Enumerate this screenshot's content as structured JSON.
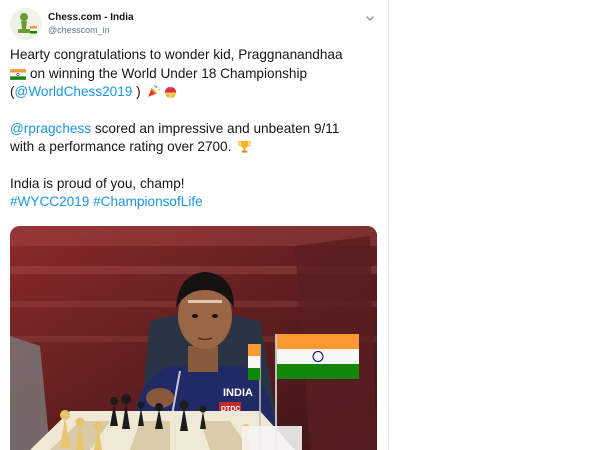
{
  "tweet": {
    "author_name": "Chess.com - India",
    "author_handle": "@chesscom_in",
    "lines": {
      "l1": "Hearty congratulations to wonder kid, Praggnanandhaa",
      "l2": "on winning the World Under 18 Championship",
      "l3a": "(",
      "l3b": "@WorldChess2019",
      "l3c": " )",
      "l4a": "@rpragchess",
      "l4b": " scored an impressive and unbeaten 9/11",
      "l5": "with a performance rating over 2700.",
      "l6": "India is proud of you, champ!",
      "l7": "#WYCC2019 #ChampionsofLife"
    },
    "emoji": [
      "india-flag",
      "party-popper",
      "confetti-ball",
      "trophy"
    ],
    "photo": {
      "jacket_text": "INDIA",
      "badge_text": "DTDC"
    }
  },
  "colors": {
    "link": "#1b95e0",
    "text": "#14171a",
    "muted": "#657786"
  }
}
